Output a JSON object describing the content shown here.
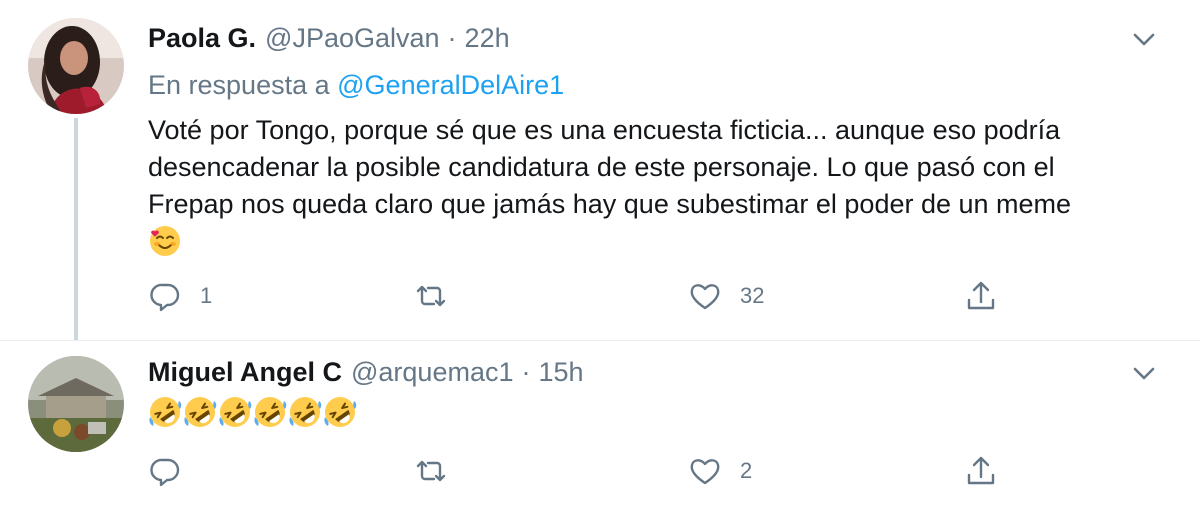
{
  "tweets": [
    {
      "name": "Paola G.",
      "handle": "@JPaoGalvan",
      "separator": "·",
      "time": "22h",
      "reply_prefix": "En respuesta a",
      "reply_handle": "@GeneralDelAire1",
      "text_lines": [
        "Voté por Tongo, porque sé que es una encuesta ficticia... aunque eso podría",
        "desencadenar la posible candidatura de este personaje. Lo que pasó con el",
        "Frepap nos queda claro que jamás hay que subestimar el poder de un meme"
      ],
      "emoji": "smiling-face-with-hearts",
      "reply_count": "1",
      "retweet_count": "",
      "like_count": "32"
    },
    {
      "name": "Miguel Angel C",
      "handle": "@arquemac1",
      "separator": "·",
      "time": "15h",
      "emoji": "rolling-on-floor-laughing",
      "emoji_count": 6,
      "reply_count": "",
      "retweet_count": "",
      "like_count": "2"
    }
  ],
  "icons": {
    "reply": "reply-icon",
    "retweet": "retweet-icon",
    "like": "heart-icon",
    "share": "share-icon",
    "caret": "chevron-down-icon"
  },
  "colors": {
    "link": "#1da1f2",
    "secondary_text": "#657786",
    "primary_text": "#14171a",
    "thread_line": "#ccd6dd",
    "divider": "#e6ecf0"
  }
}
